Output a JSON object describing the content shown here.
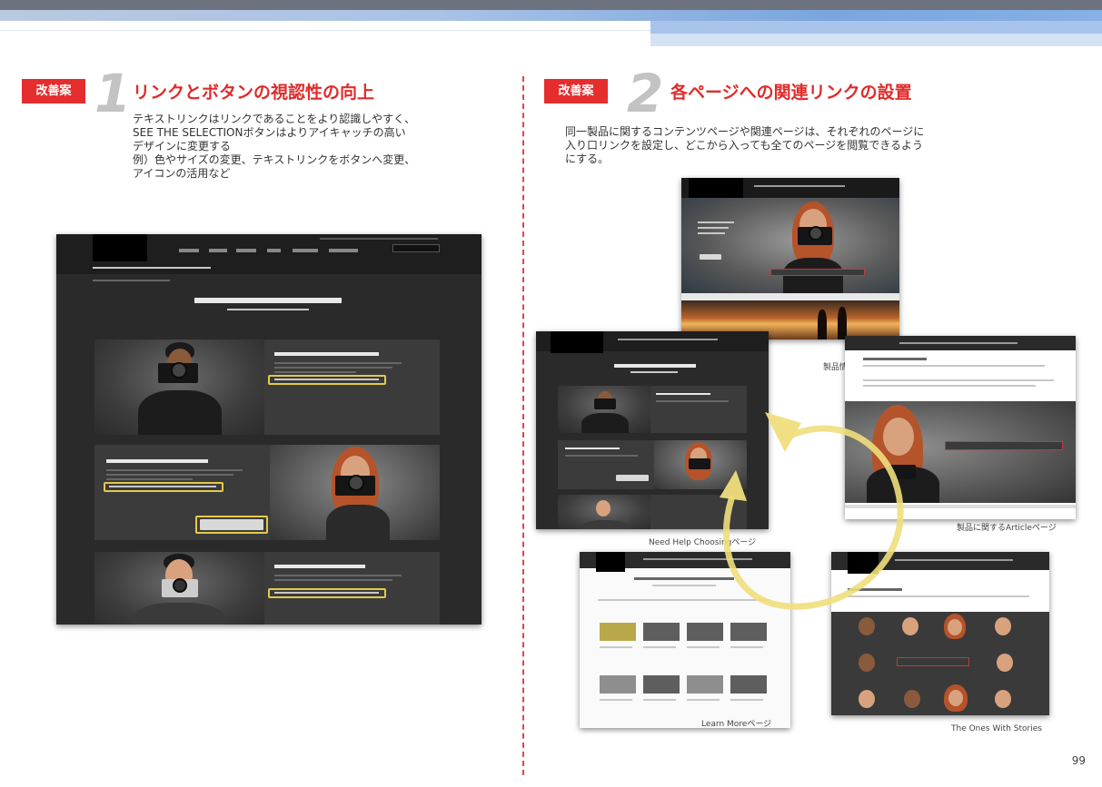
{
  "page_number": "99",
  "left": {
    "badge": "改善案",
    "number": "1",
    "title": "リンクとボタンの視認性の向上",
    "description": "テキストリンクはリンクであることをより認識しやすく、\nSEE THE SELECTIONボタンはよりアイキャッチの高い\nデザインに変更する\n例）色やサイズの変更、テキストリンクをボタンへ変更、\nアイコンの活用など",
    "mock": {
      "nav_items": [
        "Cameras",
        "Lenses",
        "Support",
        "News",
        "Where to Buy",
        "Promotions"
      ],
      "search_label": "Search Here",
      "breadcrumb": "Home  >  Cameras  >  Need Help Choosing",
      "subbar_text": "Choose products in Which LUMIX G is the One for You?",
      "hero_title": "Which LUMIX G is the One for You?",
      "hero_subtitle": "The Future of Photography in Your Hands",
      "cards": [
        {
          "title": "The One Reimagining What's Possible"
        },
        {
          "title": "The One Taking Photography Further",
          "button": "SEE THE SELECTION"
        },
        {
          "title": "The One with Visionary Style"
        }
      ]
    }
  },
  "right": {
    "badge": "改善案",
    "number": "2",
    "title": "各ページへの関連リンクの設置",
    "description": "同一製品に関するコンテンツページや関連ページは、それぞれのページに\n入り口リンクを設定し、どこから入っても全てのページを閲覧できるよう\nにする。",
    "captions": {
      "product": "製品情報ページ",
      "article": "製品に関するArticleページ",
      "need_help": "Need Help Choosingページ",
      "learn_more": "Learn Moreページ",
      "stories": "The Ones With Stories"
    },
    "mock": {
      "need_help_title": "Which LUMIX G is the One for You?",
      "article_title": "The One Taking Photography Further",
      "article_banner": "THE ONE THAT'S TAKING PHOTOGRAPHY FURTHER",
      "learn_more_title": "Lumix G Compact System Cameras (Mirrorless)",
      "stories_title": "The Ones With Stories"
    }
  },
  "colors": {
    "accent_red": "#e52d2d",
    "highlight_yellow": "#e6c84a",
    "header_blue": "#7aa6de"
  }
}
